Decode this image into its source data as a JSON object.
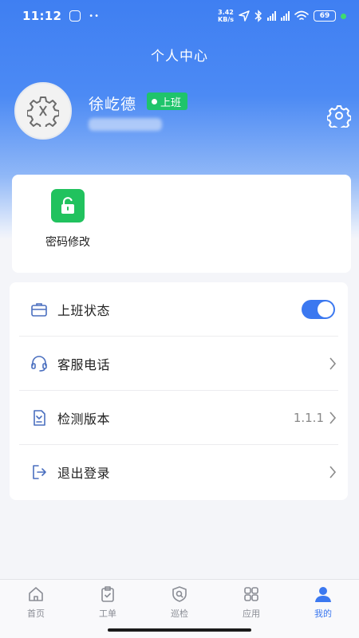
{
  "status_bar": {
    "time": "11:12",
    "dots": "••",
    "net_speed_value": "3.42",
    "net_speed_unit": "KB/s",
    "battery": "69"
  },
  "header": {
    "title": "个人中心"
  },
  "profile": {
    "name": "徐屹德",
    "status_badge": "上班"
  },
  "quick_actions": [
    {
      "label": "密码修改",
      "icon": "unlock-icon",
      "color": "#21c25e"
    }
  ],
  "menu": {
    "items": [
      {
        "label": "上班状态",
        "icon": "briefcase-icon",
        "control": "toggle",
        "toggle_on": true
      },
      {
        "label": "客服电话",
        "icon": "headset-icon",
        "control": "chevron"
      },
      {
        "label": "检测版本",
        "icon": "download-doc-icon",
        "control": "chevron",
        "value": "1.1.1"
      },
      {
        "label": "退出登录",
        "icon": "logout-icon",
        "control": "chevron"
      }
    ]
  },
  "tabs": [
    {
      "label": "首页",
      "icon": "home-icon",
      "active": false
    },
    {
      "label": "工单",
      "icon": "clipboard-check-icon",
      "active": false
    },
    {
      "label": "巡检",
      "icon": "shield-search-icon",
      "active": false
    },
    {
      "label": "应用",
      "icon": "apps-grid-icon",
      "active": false
    },
    {
      "label": "我的",
      "icon": "user-icon",
      "active": true
    }
  ],
  "colors": {
    "header_blue": "#3f7ff2",
    "accent": "#3b78f0",
    "badge_green": "#1fc46b",
    "quick_icon_green": "#21c25e"
  }
}
